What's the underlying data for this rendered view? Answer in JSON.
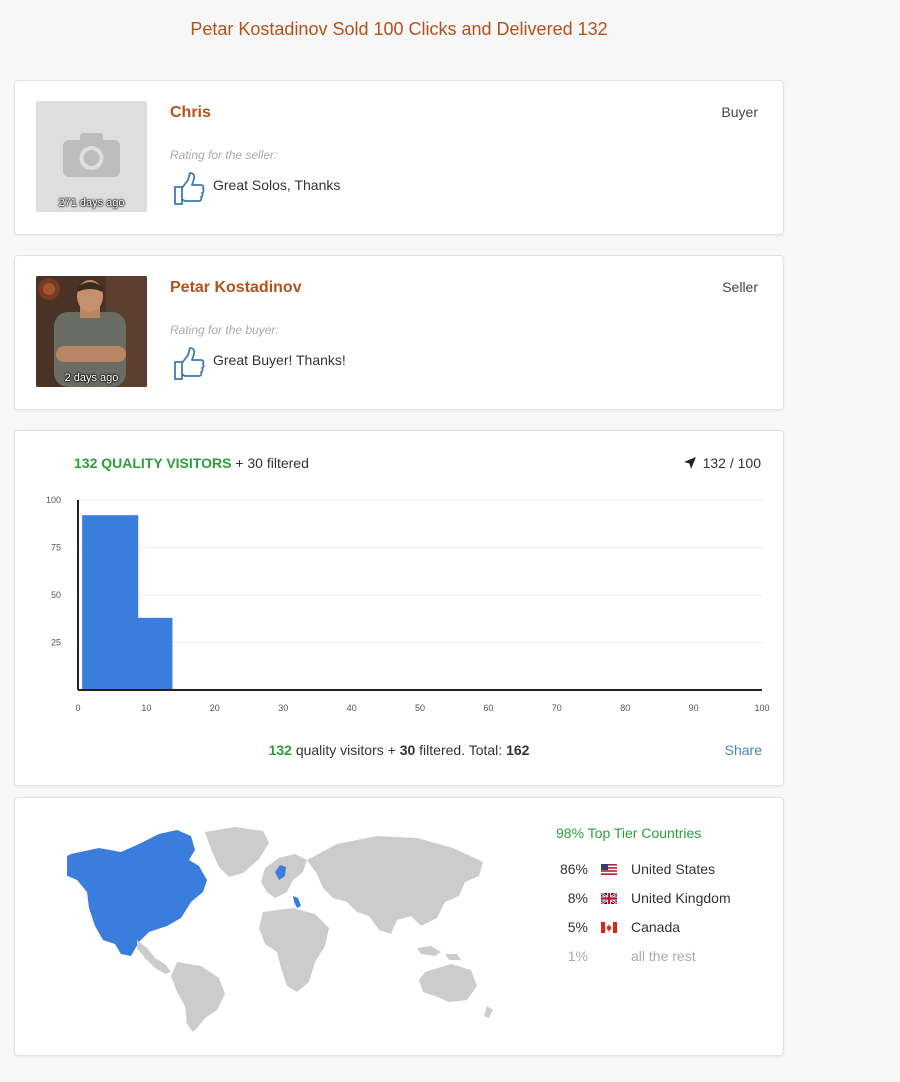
{
  "page": {
    "title": "Petar Kostadinov Sold 100 Clicks and Delivered 132"
  },
  "reviews": [
    {
      "name": "Chris",
      "role": "Buyer",
      "ago": "271 days ago",
      "rating_label": "Rating for the seller:",
      "comment": "Great Solos, Thanks",
      "thumb": "thumbs-up-icon"
    },
    {
      "name": "Petar Kostadinov",
      "role": "Seller",
      "ago": "2 days ago",
      "rating_label": "Rating for the buyer:",
      "comment": "Great Buyer! Thanks!",
      "thumb": "thumbs-up-icon"
    }
  ],
  "stats": {
    "quality_visitors_label": "132 QUALITY VISITORS",
    "filtered_label": "+ 30 filtered",
    "delivered_ratio": "132 / 100",
    "delivered_icon": "location-arrow-icon",
    "summary": {
      "quality": "132",
      "quality_text": "quality visitors +",
      "filtered": "30",
      "filtered_text": "filtered. Total:",
      "total": "162"
    },
    "share_label": "Share"
  },
  "chart_data": {
    "type": "bar",
    "x": [
      5,
      10
    ],
    "values": [
      92,
      38
    ],
    "xlim": [
      0,
      100
    ],
    "ylim": [
      0,
      100
    ],
    "x_ticks": [
      "0",
      "10",
      "20",
      "30",
      "40",
      "50",
      "60",
      "70",
      "80",
      "90",
      "100"
    ],
    "y_ticks": [
      "25",
      "50",
      "75",
      "100"
    ],
    "grid": true,
    "bar_color": "#3b7ddd"
  },
  "countries": {
    "top_tier": "98% Top Tier Countries",
    "list": [
      {
        "pct": "86%",
        "name": "United States",
        "flag": "us-flag-icon"
      },
      {
        "pct": "8%",
        "name": "United Kingdom",
        "flag": "uk-flag-icon"
      },
      {
        "pct": "5%",
        "name": "Canada",
        "flag": "canada-flag-icon"
      },
      {
        "pct": "1%",
        "name": "all the rest",
        "flag": ""
      }
    ],
    "highlight_color": "#3b7ddd",
    "land_color": "#cccccc"
  }
}
